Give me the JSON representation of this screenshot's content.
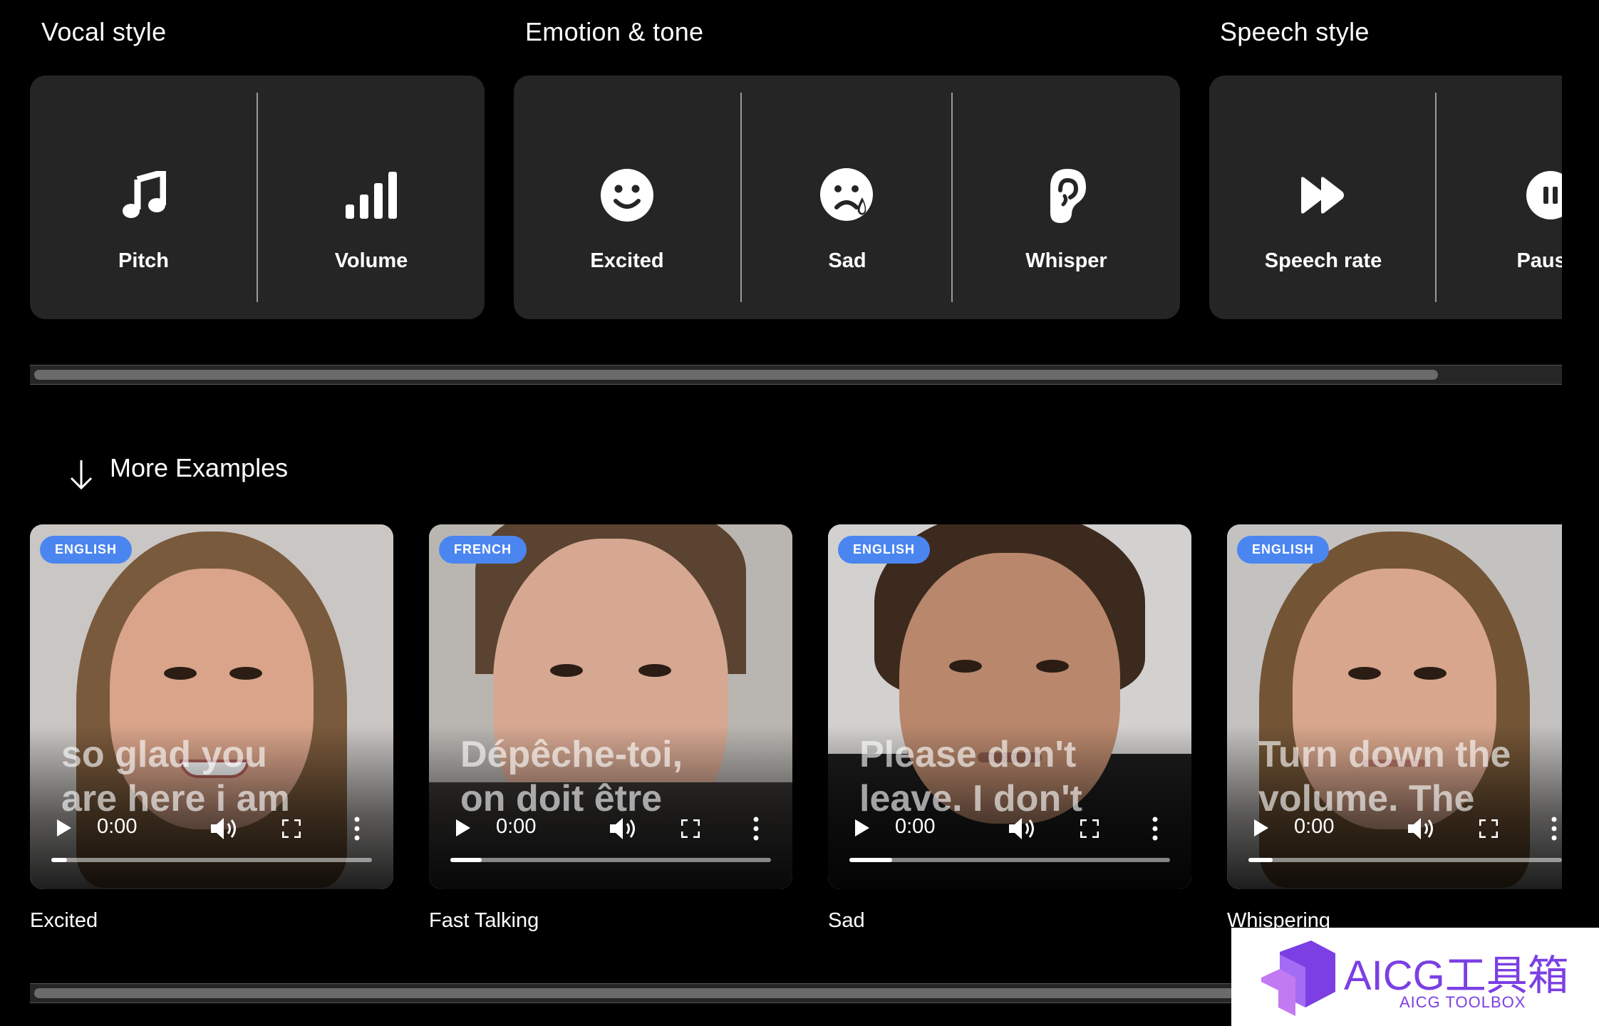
{
  "sections": {
    "vocal_style": {
      "title": "Vocal style",
      "items": [
        {
          "label": "Pitch",
          "icon": "music-note-icon"
        },
        {
          "label": "Volume",
          "icon": "volume-bars-icon"
        }
      ]
    },
    "emotion_tone": {
      "title": "Emotion & tone",
      "items": [
        {
          "label": "Excited",
          "icon": "smile-face-icon"
        },
        {
          "label": "Sad",
          "icon": "crying-face-icon"
        },
        {
          "label": "Whisper",
          "icon": "ear-icon"
        }
      ]
    },
    "speech_style": {
      "title": "Speech style",
      "items": [
        {
          "label": "Speech rate",
          "icon": "fast-forward-icon"
        },
        {
          "label": "Pausin",
          "icon": "pause-circle-icon"
        }
      ]
    }
  },
  "more_examples": {
    "label": "More Examples",
    "icon": "arrow-down-icon",
    "videos": [
      {
        "language": "ENGLISH",
        "caption_line1": "so glad you",
        "caption_line2": "are here i am",
        "time": "0:00",
        "title": "Excited"
      },
      {
        "language": "FRENCH",
        "caption_line1": "Dépêche-toi,",
        "caption_line2": "on doit être",
        "time": "0:00",
        "title": "Fast Talking"
      },
      {
        "language": "ENGLISH",
        "caption_line1": "Please don't",
        "caption_line2": "leave. I don't",
        "time": "0:00",
        "title": "Sad"
      },
      {
        "language": "ENGLISH",
        "caption_line1": "Turn down the",
        "caption_line2": "volume. The",
        "time": "0:00",
        "title": "Whispering"
      }
    ]
  },
  "watermark": {
    "title": "AICG工具箱",
    "subtitle": "AICG TOOLBOX"
  },
  "colors": {
    "background": "#000000",
    "card": "#252525",
    "badge": "#4b86f0",
    "watermark_purple": "#7b3fe4"
  }
}
